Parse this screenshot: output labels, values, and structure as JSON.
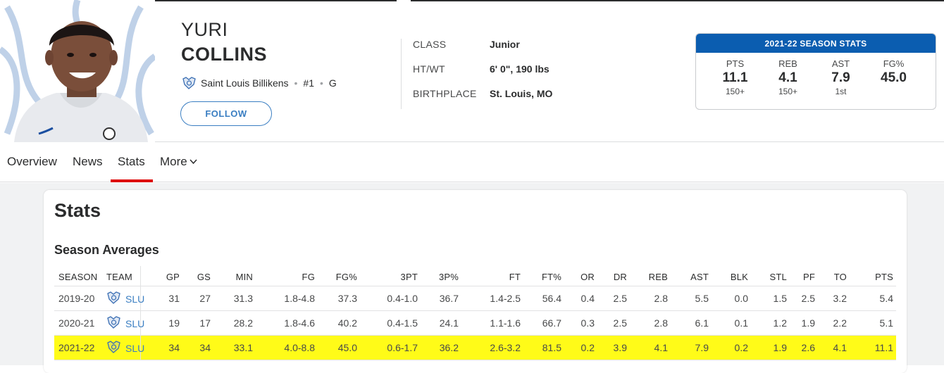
{
  "player": {
    "first_name": "YURI",
    "last_name": "COLLINS",
    "team": "Saint Louis Billikens",
    "number": "#1",
    "position": "G",
    "follow_label": "FOLLOW"
  },
  "bio": [
    {
      "label": "CLASS",
      "value": "Junior"
    },
    {
      "label": "HT/WT",
      "value": "6' 0\", 190 lbs"
    },
    {
      "label": "BIRTHPLACE",
      "value": "St. Louis, MO"
    }
  ],
  "season_card": {
    "title": "2021-22 SEASON STATS",
    "stats": [
      {
        "label": "PTS",
        "value": "11.1",
        "rank": "150+"
      },
      {
        "label": "REB",
        "value": "4.1",
        "rank": "150+"
      },
      {
        "label": "AST",
        "value": "7.9",
        "rank": "1st"
      },
      {
        "label": "FG%",
        "value": "45.0",
        "rank": ""
      }
    ]
  },
  "nav": {
    "items": [
      "Overview",
      "News",
      "Stats",
      "More"
    ],
    "active": "Stats"
  },
  "stats_page": {
    "title": "Stats",
    "section": "Season Averages"
  },
  "table": {
    "columns": [
      "SEASON",
      "TEAM",
      "GP",
      "GS",
      "MIN",
      "FG",
      "FG%",
      "3PT",
      "3P%",
      "FT",
      "FT%",
      "OR",
      "DR",
      "REB",
      "AST",
      "BLK",
      "STL",
      "PF",
      "TO",
      "PTS"
    ],
    "rows": [
      [
        "2019-20",
        "SLU",
        "31",
        "27",
        "31.3",
        "1.8-4.8",
        "37.3",
        "0.4-1.0",
        "36.7",
        "1.4-2.5",
        "56.4",
        "0.4",
        "2.5",
        "2.8",
        "5.5",
        "0.0",
        "1.5",
        "2.5",
        "3.2",
        "5.4"
      ],
      [
        "2020-21",
        "SLU",
        "19",
        "17",
        "28.2",
        "1.8-4.6",
        "40.2",
        "0.4-1.5",
        "24.1",
        "1.1-1.6",
        "66.7",
        "0.3",
        "2.5",
        "2.8",
        "6.1",
        "0.1",
        "1.2",
        "1.9",
        "2.2",
        "5.1"
      ],
      [
        "2021-22",
        "SLU",
        "34",
        "34",
        "33.1",
        "4.0-8.8",
        "45.0",
        "0.6-1.7",
        "36.2",
        "2.6-3.2",
        "81.5",
        "0.2",
        "3.9",
        "4.1",
        "7.9",
        "0.2",
        "1.9",
        "2.6",
        "4.1",
        "11.1"
      ]
    ],
    "highlight_row": 2,
    "highlight_color": "#fffb18"
  },
  "colors": {
    "accent_blue": "#0b5db0",
    "link_blue": "#3a7ec2",
    "active_red": "#dd0000"
  }
}
